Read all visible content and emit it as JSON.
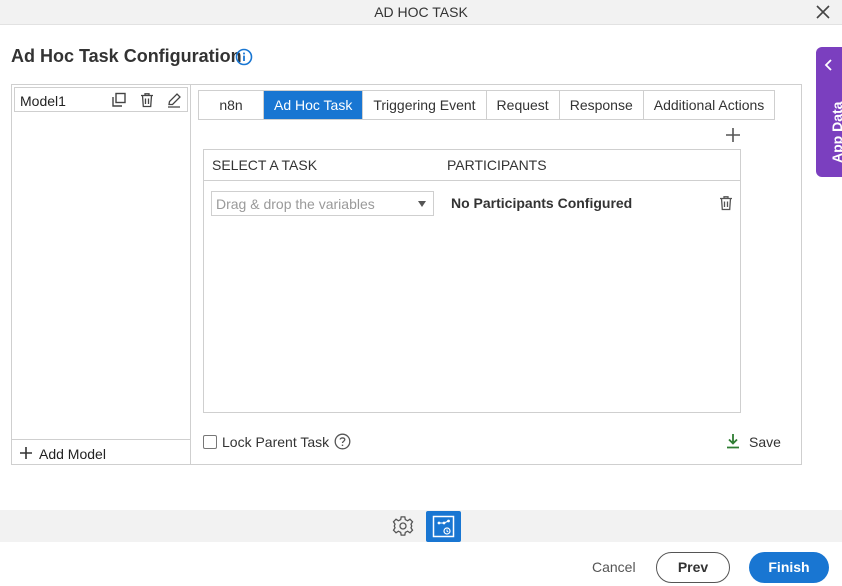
{
  "window": {
    "title": "AD HOC TASK"
  },
  "page": {
    "title": "Ad Hoc Task Configuration"
  },
  "app_data": {
    "label": "App Data"
  },
  "models": {
    "items": [
      {
        "name": "Model1"
      }
    ],
    "add_label": "Add Model"
  },
  "tabs": [
    {
      "label": "n8n",
      "active": false
    },
    {
      "label": "Ad Hoc Task",
      "active": true
    },
    {
      "label": "Triggering Event",
      "active": false
    },
    {
      "label": "Request",
      "active": false
    },
    {
      "label": "Response",
      "active": false
    },
    {
      "label": "Additional Actions",
      "active": false
    }
  ],
  "grid": {
    "headers": {
      "task": "SELECT A TASK",
      "participants": "PARTICIPANTS"
    },
    "row": {
      "task_placeholder": "Drag & drop the variables",
      "participants": "No Participants Configured"
    }
  },
  "lock_parent": {
    "label": "Lock Parent Task",
    "checked": false
  },
  "save": {
    "label": "Save"
  },
  "footer": {
    "cancel": "Cancel",
    "prev": "Prev",
    "finish": "Finish"
  },
  "colors": {
    "accent": "#1976d2",
    "app_data_tab": "#7b3fbf",
    "save_icon": "#2e7d32"
  }
}
